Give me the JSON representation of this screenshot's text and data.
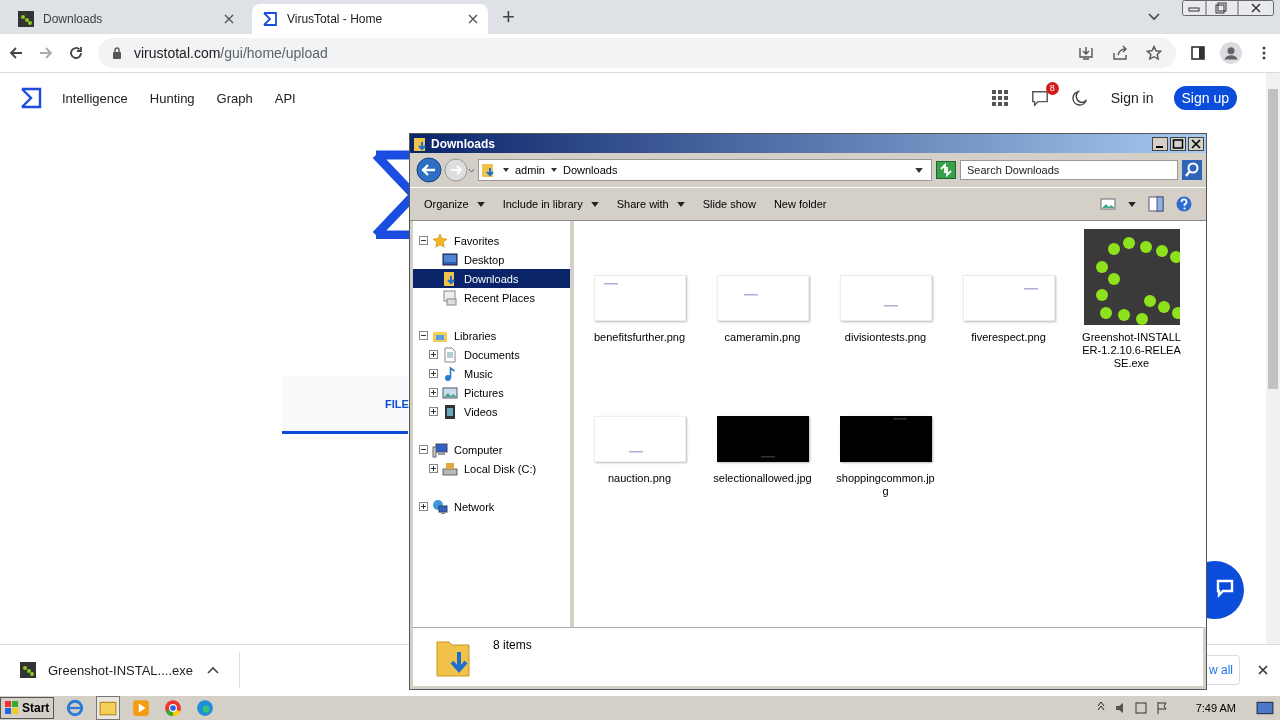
{
  "browser": {
    "tabs": [
      {
        "title": "Downloads",
        "selected": false,
        "kind": "greenshot"
      },
      {
        "title": "VirusTotal - Home",
        "selected": true,
        "kind": "virustotal"
      }
    ],
    "new_tab": "+",
    "url_host": "virustotal.com",
    "url_path": "/gui/home/upload"
  },
  "site": {
    "nav": [
      "Intelligence",
      "Hunting",
      "Graph",
      "API"
    ],
    "notification_count": "8",
    "sign_in": "Sign in",
    "sign_up": "Sign up",
    "file_tab": "FILE"
  },
  "explorer": {
    "title": "Downloads",
    "breadcrumb": [
      "admin",
      "Downloads"
    ],
    "search": {
      "placeholder": "Search Downloads"
    },
    "toolbar": [
      {
        "label": "Organize",
        "dropdown": true
      },
      {
        "label": "Include in library",
        "dropdown": true
      },
      {
        "label": "Share with",
        "dropdown": true
      },
      {
        "label": "Slide show",
        "dropdown": false
      },
      {
        "label": "New folder",
        "dropdown": false
      }
    ],
    "tree": [
      {
        "label": "Favorites",
        "kind": "star",
        "expanded": true,
        "selected": false,
        "children": [
          {
            "label": "Desktop",
            "kind": "desktop",
            "selected": false
          },
          {
            "label": "Downloads",
            "kind": "downloads",
            "selected": true
          },
          {
            "label": "Recent Places",
            "kind": "recent",
            "selected": false
          }
        ]
      },
      {
        "label": "Libraries",
        "kind": "library",
        "expanded": true,
        "selected": false,
        "children": [
          {
            "label": "Documents",
            "kind": "document",
            "expanded": false,
            "selected": false
          },
          {
            "label": "Music",
            "kind": "music",
            "expanded": false,
            "selected": false
          },
          {
            "label": "Pictures",
            "kind": "pictures",
            "expanded": false,
            "selected": false
          },
          {
            "label": "Videos",
            "kind": "videos",
            "expanded": false,
            "selected": false
          }
        ]
      },
      {
        "label": "Computer",
        "kind": "computer",
        "expanded": true,
        "selected": false,
        "children": [
          {
            "label": "Local Disk (C:)",
            "kind": "disk",
            "expanded": false,
            "selected": false
          }
        ]
      },
      {
        "label": "Network",
        "kind": "network",
        "expanded": false,
        "selected": false
      }
    ],
    "files": [
      {
        "name": "benefitsfurther.png",
        "kind": "light"
      },
      {
        "name": "cameramin.png",
        "kind": "light"
      },
      {
        "name": "divisiontests.png",
        "kind": "light"
      },
      {
        "name": "fiverespect.png",
        "kind": "light"
      },
      {
        "name": "Greenshot-INSTALLER-1.2.10.6-RELEASE.exe",
        "kind": "app"
      },
      {
        "name": "nauction.png",
        "kind": "light"
      },
      {
        "name": "selectionallowed.jpg",
        "kind": "dark"
      },
      {
        "name": "shoppingcommon.jpg",
        "kind": "dark"
      }
    ],
    "status": "8 items"
  },
  "download_bar": {
    "file": "Greenshot-INSTAL....exe",
    "show_all": "w all"
  },
  "taskbar": {
    "start": "Start",
    "time": "7:49 AM"
  }
}
